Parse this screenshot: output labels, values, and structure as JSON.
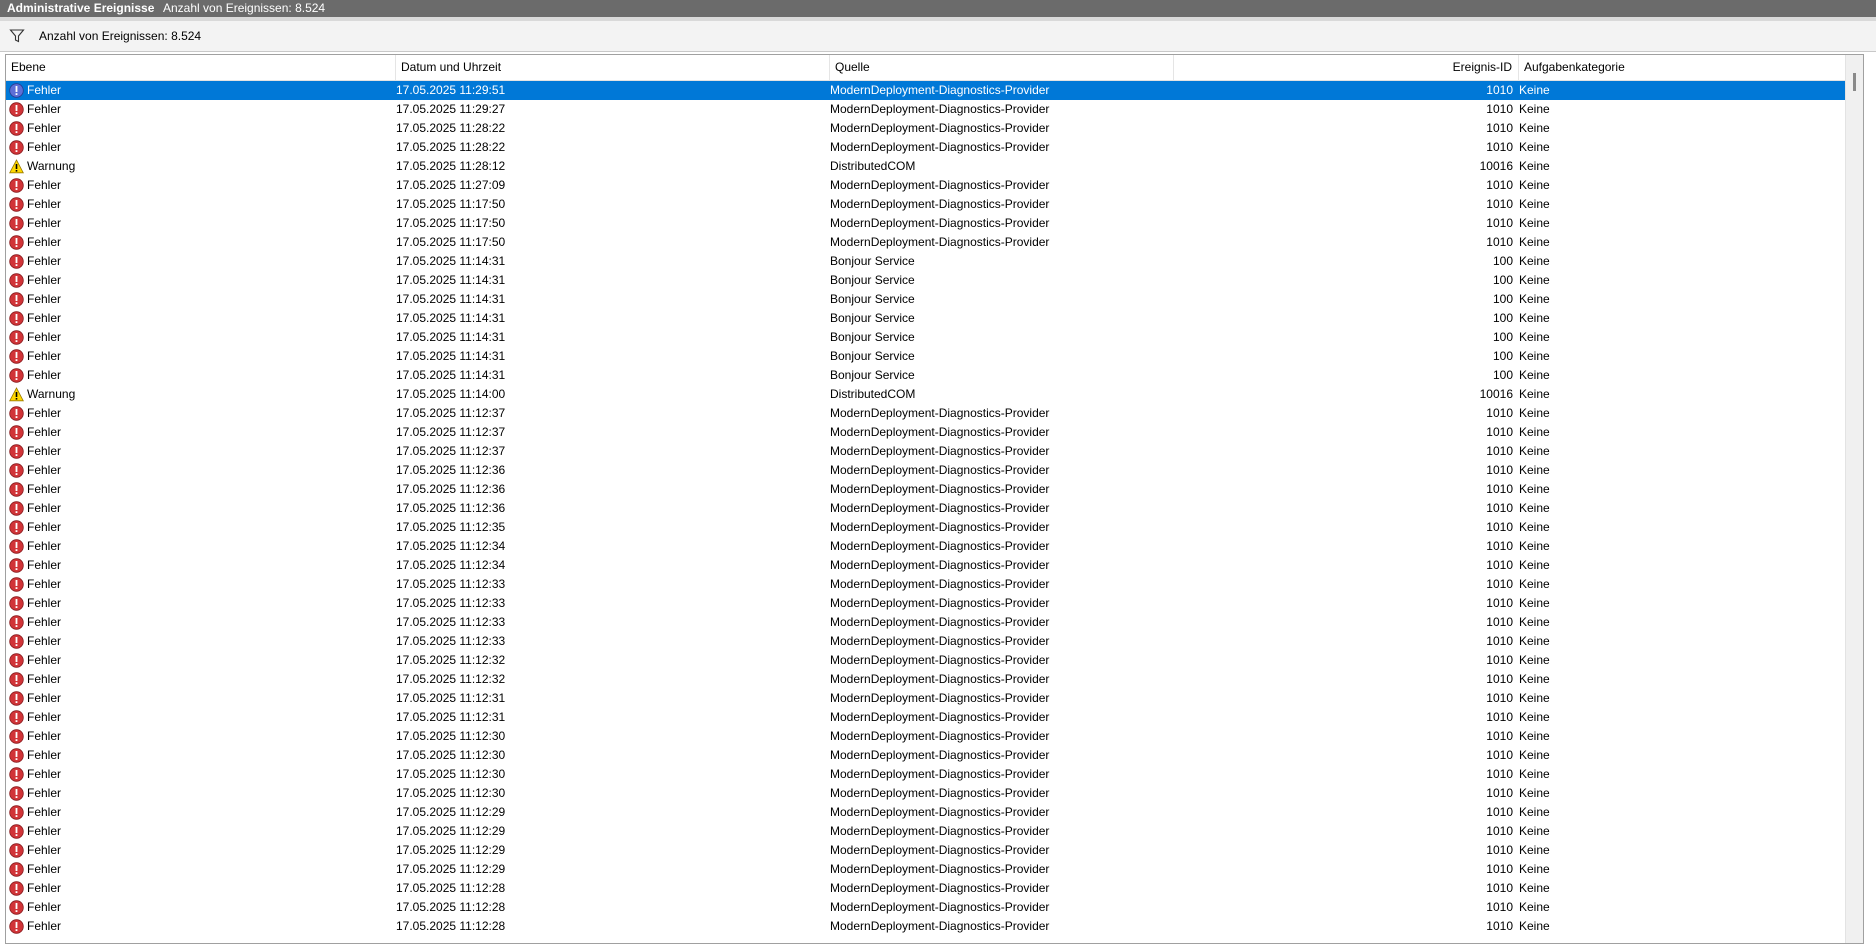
{
  "titlebar": {
    "title": "Administrative Ereignisse",
    "count": "Anzahl von Ereignissen: 8.524"
  },
  "filterbar": {
    "icon": "filter-icon",
    "count": "Anzahl von Ereignissen: 8.524"
  },
  "columns": {
    "level": "Ebene",
    "date": "Datum und Uhrzeit",
    "source": "Quelle",
    "event_id": "Ereignis-ID",
    "category": "Aufgabenkategorie"
  },
  "colors": {
    "selection": "#0078d7",
    "error": "#d13438",
    "warning": "#ffd800"
  },
  "selected_row": 0,
  "rows": [
    {
      "level": "Fehler",
      "type": "error",
      "date": "17.05.2025 11:29:51",
      "source": "ModernDeployment-Diagnostics-Provider",
      "id": "1010",
      "category": "Keine"
    },
    {
      "level": "Fehler",
      "type": "error",
      "date": "17.05.2025 11:29:27",
      "source": "ModernDeployment-Diagnostics-Provider",
      "id": "1010",
      "category": "Keine"
    },
    {
      "level": "Fehler",
      "type": "error",
      "date": "17.05.2025 11:28:22",
      "source": "ModernDeployment-Diagnostics-Provider",
      "id": "1010",
      "category": "Keine"
    },
    {
      "level": "Fehler",
      "type": "error",
      "date": "17.05.2025 11:28:22",
      "source": "ModernDeployment-Diagnostics-Provider",
      "id": "1010",
      "category": "Keine"
    },
    {
      "level": "Warnung",
      "type": "warning",
      "date": "17.05.2025 11:28:12",
      "source": "DistributedCOM",
      "id": "10016",
      "category": "Keine"
    },
    {
      "level": "Fehler",
      "type": "error",
      "date": "17.05.2025 11:27:09",
      "source": "ModernDeployment-Diagnostics-Provider",
      "id": "1010",
      "category": "Keine"
    },
    {
      "level": "Fehler",
      "type": "error",
      "date": "17.05.2025 11:17:50",
      "source": "ModernDeployment-Diagnostics-Provider",
      "id": "1010",
      "category": "Keine"
    },
    {
      "level": "Fehler",
      "type": "error",
      "date": "17.05.2025 11:17:50",
      "source": "ModernDeployment-Diagnostics-Provider",
      "id": "1010",
      "category": "Keine"
    },
    {
      "level": "Fehler",
      "type": "error",
      "date": "17.05.2025 11:17:50",
      "source": "ModernDeployment-Diagnostics-Provider",
      "id": "1010",
      "category": "Keine"
    },
    {
      "level": "Fehler",
      "type": "error",
      "date": "17.05.2025 11:14:31",
      "source": "Bonjour Service",
      "id": "100",
      "category": "Keine"
    },
    {
      "level": "Fehler",
      "type": "error",
      "date": "17.05.2025 11:14:31",
      "source": "Bonjour Service",
      "id": "100",
      "category": "Keine"
    },
    {
      "level": "Fehler",
      "type": "error",
      "date": "17.05.2025 11:14:31",
      "source": "Bonjour Service",
      "id": "100",
      "category": "Keine"
    },
    {
      "level": "Fehler",
      "type": "error",
      "date": "17.05.2025 11:14:31",
      "source": "Bonjour Service",
      "id": "100",
      "category": "Keine"
    },
    {
      "level": "Fehler",
      "type": "error",
      "date": "17.05.2025 11:14:31",
      "source": "Bonjour Service",
      "id": "100",
      "category": "Keine"
    },
    {
      "level": "Fehler",
      "type": "error",
      "date": "17.05.2025 11:14:31",
      "source": "Bonjour Service",
      "id": "100",
      "category": "Keine"
    },
    {
      "level": "Fehler",
      "type": "error",
      "date": "17.05.2025 11:14:31",
      "source": "Bonjour Service",
      "id": "100",
      "category": "Keine"
    },
    {
      "level": "Warnung",
      "type": "warning",
      "date": "17.05.2025 11:14:00",
      "source": "DistributedCOM",
      "id": "10016",
      "category": "Keine"
    },
    {
      "level": "Fehler",
      "type": "error",
      "date": "17.05.2025 11:12:37",
      "source": "ModernDeployment-Diagnostics-Provider",
      "id": "1010",
      "category": "Keine"
    },
    {
      "level": "Fehler",
      "type": "error",
      "date": "17.05.2025 11:12:37",
      "source": "ModernDeployment-Diagnostics-Provider",
      "id": "1010",
      "category": "Keine"
    },
    {
      "level": "Fehler",
      "type": "error",
      "date": "17.05.2025 11:12:37",
      "source": "ModernDeployment-Diagnostics-Provider",
      "id": "1010",
      "category": "Keine"
    },
    {
      "level": "Fehler",
      "type": "error",
      "date": "17.05.2025 11:12:36",
      "source": "ModernDeployment-Diagnostics-Provider",
      "id": "1010",
      "category": "Keine"
    },
    {
      "level": "Fehler",
      "type": "error",
      "date": "17.05.2025 11:12:36",
      "source": "ModernDeployment-Diagnostics-Provider",
      "id": "1010",
      "category": "Keine"
    },
    {
      "level": "Fehler",
      "type": "error",
      "date": "17.05.2025 11:12:36",
      "source": "ModernDeployment-Diagnostics-Provider",
      "id": "1010",
      "category": "Keine"
    },
    {
      "level": "Fehler",
      "type": "error",
      "date": "17.05.2025 11:12:35",
      "source": "ModernDeployment-Diagnostics-Provider",
      "id": "1010",
      "category": "Keine"
    },
    {
      "level": "Fehler",
      "type": "error",
      "date": "17.05.2025 11:12:34",
      "source": "ModernDeployment-Diagnostics-Provider",
      "id": "1010",
      "category": "Keine"
    },
    {
      "level": "Fehler",
      "type": "error",
      "date": "17.05.2025 11:12:34",
      "source": "ModernDeployment-Diagnostics-Provider",
      "id": "1010",
      "category": "Keine"
    },
    {
      "level": "Fehler",
      "type": "error",
      "date": "17.05.2025 11:12:33",
      "source": "ModernDeployment-Diagnostics-Provider",
      "id": "1010",
      "category": "Keine"
    },
    {
      "level": "Fehler",
      "type": "error",
      "date": "17.05.2025 11:12:33",
      "source": "ModernDeployment-Diagnostics-Provider",
      "id": "1010",
      "category": "Keine"
    },
    {
      "level": "Fehler",
      "type": "error",
      "date": "17.05.2025 11:12:33",
      "source": "ModernDeployment-Diagnostics-Provider",
      "id": "1010",
      "category": "Keine"
    },
    {
      "level": "Fehler",
      "type": "error",
      "date": "17.05.2025 11:12:33",
      "source": "ModernDeployment-Diagnostics-Provider",
      "id": "1010",
      "category": "Keine"
    },
    {
      "level": "Fehler",
      "type": "error",
      "date": "17.05.2025 11:12:32",
      "source": "ModernDeployment-Diagnostics-Provider",
      "id": "1010",
      "category": "Keine"
    },
    {
      "level": "Fehler",
      "type": "error",
      "date": "17.05.2025 11:12:32",
      "source": "ModernDeployment-Diagnostics-Provider",
      "id": "1010",
      "category": "Keine"
    },
    {
      "level": "Fehler",
      "type": "error",
      "date": "17.05.2025 11:12:31",
      "source": "ModernDeployment-Diagnostics-Provider",
      "id": "1010",
      "category": "Keine"
    },
    {
      "level": "Fehler",
      "type": "error",
      "date": "17.05.2025 11:12:31",
      "source": "ModernDeployment-Diagnostics-Provider",
      "id": "1010",
      "category": "Keine"
    },
    {
      "level": "Fehler",
      "type": "error",
      "date": "17.05.2025 11:12:30",
      "source": "ModernDeployment-Diagnostics-Provider",
      "id": "1010",
      "category": "Keine"
    },
    {
      "level": "Fehler",
      "type": "error",
      "date": "17.05.2025 11:12:30",
      "source": "ModernDeployment-Diagnostics-Provider",
      "id": "1010",
      "category": "Keine"
    },
    {
      "level": "Fehler",
      "type": "error",
      "date": "17.05.2025 11:12:30",
      "source": "ModernDeployment-Diagnostics-Provider",
      "id": "1010",
      "category": "Keine"
    },
    {
      "level": "Fehler",
      "type": "error",
      "date": "17.05.2025 11:12:30",
      "source": "ModernDeployment-Diagnostics-Provider",
      "id": "1010",
      "category": "Keine"
    },
    {
      "level": "Fehler",
      "type": "error",
      "date": "17.05.2025 11:12:29",
      "source": "ModernDeployment-Diagnostics-Provider",
      "id": "1010",
      "category": "Keine"
    },
    {
      "level": "Fehler",
      "type": "error",
      "date": "17.05.2025 11:12:29",
      "source": "ModernDeployment-Diagnostics-Provider",
      "id": "1010",
      "category": "Keine"
    },
    {
      "level": "Fehler",
      "type": "error",
      "date": "17.05.2025 11:12:29",
      "source": "ModernDeployment-Diagnostics-Provider",
      "id": "1010",
      "category": "Keine"
    },
    {
      "level": "Fehler",
      "type": "error",
      "date": "17.05.2025 11:12:29",
      "source": "ModernDeployment-Diagnostics-Provider",
      "id": "1010",
      "category": "Keine"
    },
    {
      "level": "Fehler",
      "type": "error",
      "date": "17.05.2025 11:12:28",
      "source": "ModernDeployment-Diagnostics-Provider",
      "id": "1010",
      "category": "Keine"
    },
    {
      "level": "Fehler",
      "type": "error",
      "date": "17.05.2025 11:12:28",
      "source": "ModernDeployment-Diagnostics-Provider",
      "id": "1010",
      "category": "Keine"
    },
    {
      "level": "Fehler",
      "type": "error",
      "date": "17.05.2025 11:12:28",
      "source": "ModernDeployment-Diagnostics-Provider",
      "id": "1010",
      "category": "Keine"
    }
  ]
}
